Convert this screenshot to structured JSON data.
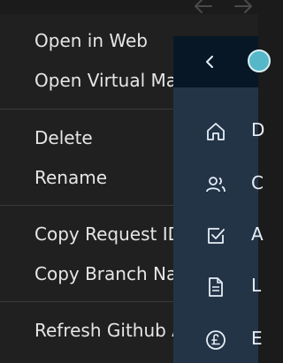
{
  "nav": {
    "back_icon": "arrow-left-icon",
    "forward_icon": "arrow-right-icon"
  },
  "context_menu": {
    "items": [
      {
        "label": "Open in Web"
      },
      {
        "label": "Open Virtual Ma"
      },
      {
        "label": "Delete"
      },
      {
        "label": "Rename"
      },
      {
        "label": "Copy Request ID"
      },
      {
        "label": "Copy Branch Na"
      },
      {
        "label": "Refresh Github A"
      }
    ]
  },
  "side_panel": {
    "items": [
      {
        "icon": "home-icon",
        "label": "D"
      },
      {
        "icon": "users-icon",
        "label": "C"
      },
      {
        "icon": "checkbox-icon",
        "label": "A"
      },
      {
        "icon": "document-icon",
        "label": "L"
      },
      {
        "icon": "pound-coin-icon",
        "label": "E"
      }
    ]
  },
  "colors": {
    "menu_bg": "#202020",
    "panel_bg": "#243447",
    "panel_header_bg": "#081726",
    "text": "#e6e6e6"
  }
}
